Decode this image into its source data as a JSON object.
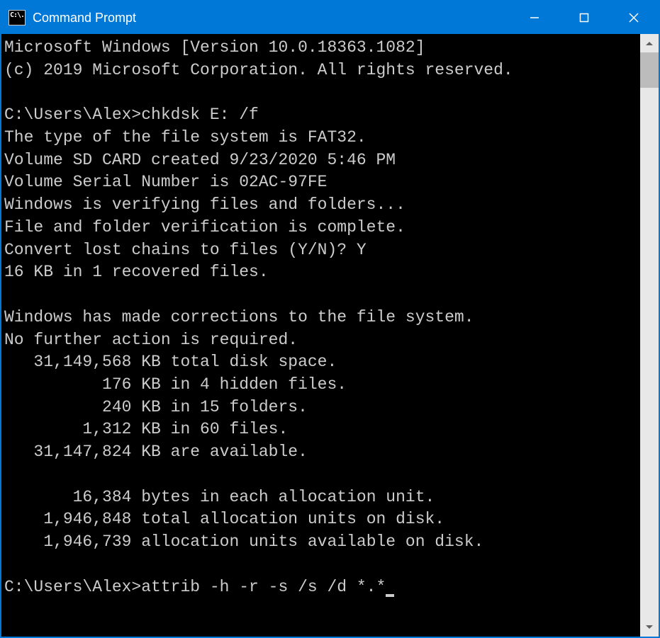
{
  "titlebar": {
    "title": "Command Prompt",
    "icon_text": "C:\\."
  },
  "terminal": {
    "lines": [
      "Microsoft Windows [Version 10.0.18363.1082]",
      "(c) 2019 Microsoft Corporation. All rights reserved.",
      "",
      "C:\\Users\\Alex>chkdsk E: /f",
      "The type of the file system is FAT32.",
      "Volume SD CARD created 9/23/2020 5:46 PM",
      "Volume Serial Number is 02AC-97FE",
      "Windows is verifying files and folders...",
      "File and folder verification is complete.",
      "Convert lost chains to files (Y/N)? Y",
      "16 KB in 1 recovered files.",
      "",
      "Windows has made corrections to the file system.",
      "No further action is required.",
      "   31,149,568 KB total disk space.",
      "          176 KB in 4 hidden files.",
      "          240 KB in 15 folders.",
      "        1,312 KB in 60 files.",
      "   31,147,824 KB are available.",
      "",
      "       16,384 bytes in each allocation unit.",
      "    1,946,848 total allocation units on disk.",
      "    1,946,739 allocation units available on disk.",
      ""
    ],
    "current_prompt": "C:\\Users\\Alex>",
    "current_input": "attrib -h -r -s /s /d *.*"
  }
}
